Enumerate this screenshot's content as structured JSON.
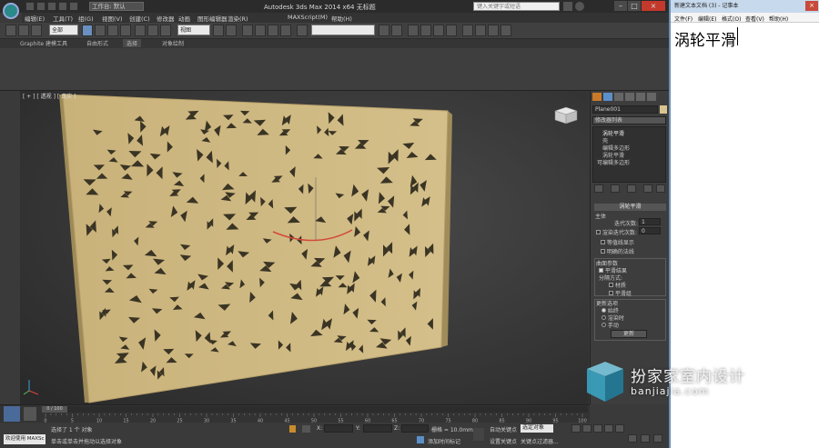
{
  "max": {
    "title": "Autodesk 3ds Max 2014 x64   无标题",
    "workspace": "工作台: 默认",
    "search_placeholder": "键入关键字或短语",
    "menu": [
      "编辑(E)",
      "工具(T)",
      "组(G)",
      "视图(V)",
      "创建(C)",
      "修改器",
      "动画",
      "图形编辑器",
      "渲染(R)",
      "MAXScript(M)",
      "帮助(H)"
    ],
    "selection_filter": "全部",
    "view_dropdown": "视图",
    "ribbon_tabs": [
      "Graphite 建模工具",
      "自由形式",
      "选择",
      "对象绘制"
    ],
    "viewport_label": "[ + ] [ 透视 ] [ 真实 ]",
    "object_name": "Plane001",
    "modifier_list": "修改器列表",
    "stack": [
      "涡轮平滑",
      "壳",
      "编辑多边形",
      "涡轮平滑",
      "可编辑多边形"
    ],
    "rollout_title": "涡轮平滑",
    "main_label": "主体",
    "iterations_label": "迭代次数:",
    "iterations_value": "1",
    "render_iters_label": "渲染迭代次数:",
    "render_iters_value": "0",
    "isoline": "等值线显示",
    "explicit_normals": "明确的法线",
    "surface_params": "曲面参数",
    "smooth_result": "平滑结果",
    "separate_by": "分隔方式:",
    "materials": "材质",
    "smoothing_groups": "平滑组",
    "update_options": "更新选项",
    "always": "始终",
    "when_rendering": "渲染时",
    "manually": "手动",
    "update_btn": "更新",
    "timeline_pos": "0 / 100",
    "ticks": [
      "0",
      "5",
      "10",
      "15",
      "20",
      "25",
      "30",
      "35",
      "40",
      "45",
      "50",
      "55",
      "60",
      "65",
      "70",
      "75",
      "80",
      "85",
      "90",
      "95",
      "100"
    ],
    "welcome": "欢迎使用 MAXSc",
    "status1": "选择了 1 个 对象",
    "status2": "单击或单击并拖动以选择对象",
    "x_label": "X:",
    "y_label": "Y:",
    "z_label": "Z:",
    "grid": "栅格 = 10.0mm",
    "auto_key": "自动关键点",
    "selected_object": "选定对象",
    "set_key": "设置关键点",
    "key_filters": "关键点过滤器...",
    "add_time_tag": "添加时间标记"
  },
  "notepad": {
    "title": "新建文本文档 (3) - 记事本",
    "menu": [
      "文件(F)",
      "编辑(E)",
      "格式(O)",
      "查看(V)",
      "帮助(H)"
    ],
    "text": "涡轮平滑"
  },
  "watermark": {
    "cn": "扮家家室内设计",
    "url": "banjiajia.com"
  }
}
